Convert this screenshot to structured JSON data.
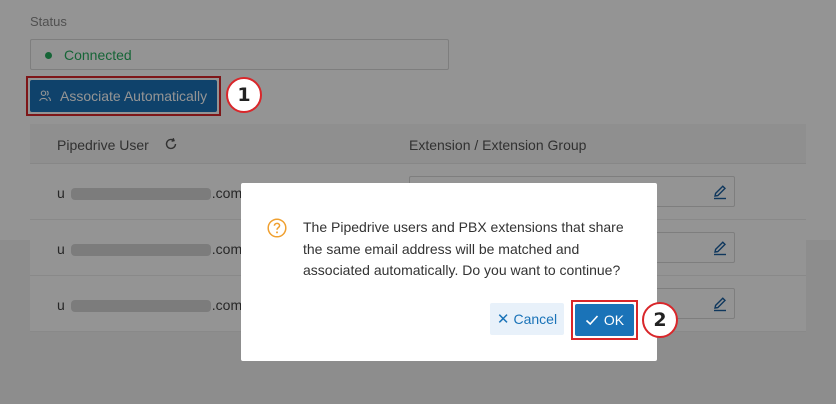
{
  "status": {
    "label": "Status",
    "value": "Connected",
    "color": "#27ae60"
  },
  "associate_button": {
    "label": "Associate Automatically",
    "icon": "users-icon"
  },
  "table": {
    "columns": [
      "Pipedrive User",
      "Extension / Extension Group"
    ],
    "rows": [
      {
        "email_prefix": "u",
        "email_suffix": ".com"
      },
      {
        "email_prefix": "u",
        "email_suffix": ".com"
      },
      {
        "email_prefix": "u",
        "email_suffix": ".com"
      }
    ]
  },
  "dialog": {
    "message": "The Pipedrive users and PBX extensions that share the same email address will be matched and associated automatically. Do you want to continue?",
    "cancel_label": "Cancel",
    "ok_label": "OK",
    "icon": "question-icon"
  },
  "steps": [
    "1",
    "2"
  ],
  "colors": {
    "primary": "#1a73b8",
    "highlight": "#d9262a",
    "warning": "#f0a030"
  }
}
